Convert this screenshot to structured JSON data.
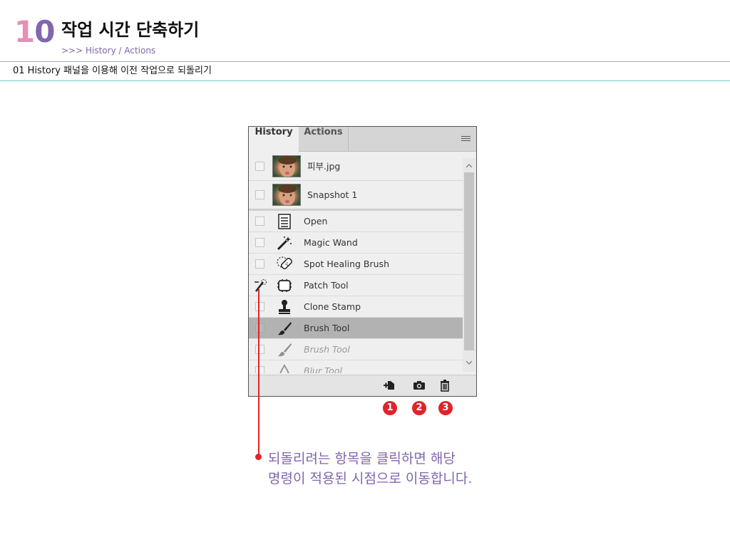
{
  "header": {
    "chapter_digit1": "1",
    "chapter_digit2": "0",
    "title": "작업 시간 단축하기",
    "subtitle": ">>> History / Actions",
    "section": "01 History 패널을 이용해 이전 작업으로 되돌리기"
  },
  "panel": {
    "tabs": [
      {
        "label": "History",
        "active": true
      },
      {
        "label": "Actions",
        "active": false
      }
    ],
    "snapshots": [
      {
        "label": "피부.jpg",
        "icon": "photo-thumbnail"
      },
      {
        "label": "Snapshot 1",
        "icon": "photo-thumbnail"
      }
    ],
    "states": [
      {
        "label": "Open",
        "icon": "document-icon"
      },
      {
        "label": "Magic Wand",
        "icon": "magic-wand-icon"
      },
      {
        "label": "Spot Healing Brush",
        "icon": "bandage-icon"
      },
      {
        "label": "Patch Tool",
        "icon": "patch-icon"
      },
      {
        "label": "Clone Stamp",
        "icon": "stamp-icon"
      },
      {
        "label": "Brush Tool",
        "icon": "brush-icon",
        "selected": true
      },
      {
        "label": "Brush Tool",
        "icon": "brush-icon",
        "dimmed": true
      },
      {
        "label": "Blur Tool",
        "icon": "blur-icon",
        "dimmed": true
      }
    ],
    "footer_buttons": [
      "new-document-from-state",
      "new-snapshot",
      "delete-state"
    ]
  },
  "badges": [
    "1",
    "2",
    "3"
  ],
  "callout": {
    "line1": "되돌리려는 항목을 클릭하면 해당",
    "line2": "명령이 적용된 시점으로 이동합니다."
  },
  "colors": {
    "accent_purple": "#7f66ad",
    "accent_pink": "#e78fb5",
    "rule": "#6fcac4",
    "badge_red": "#e0242a",
    "selected_row": "#b2b2b2"
  }
}
